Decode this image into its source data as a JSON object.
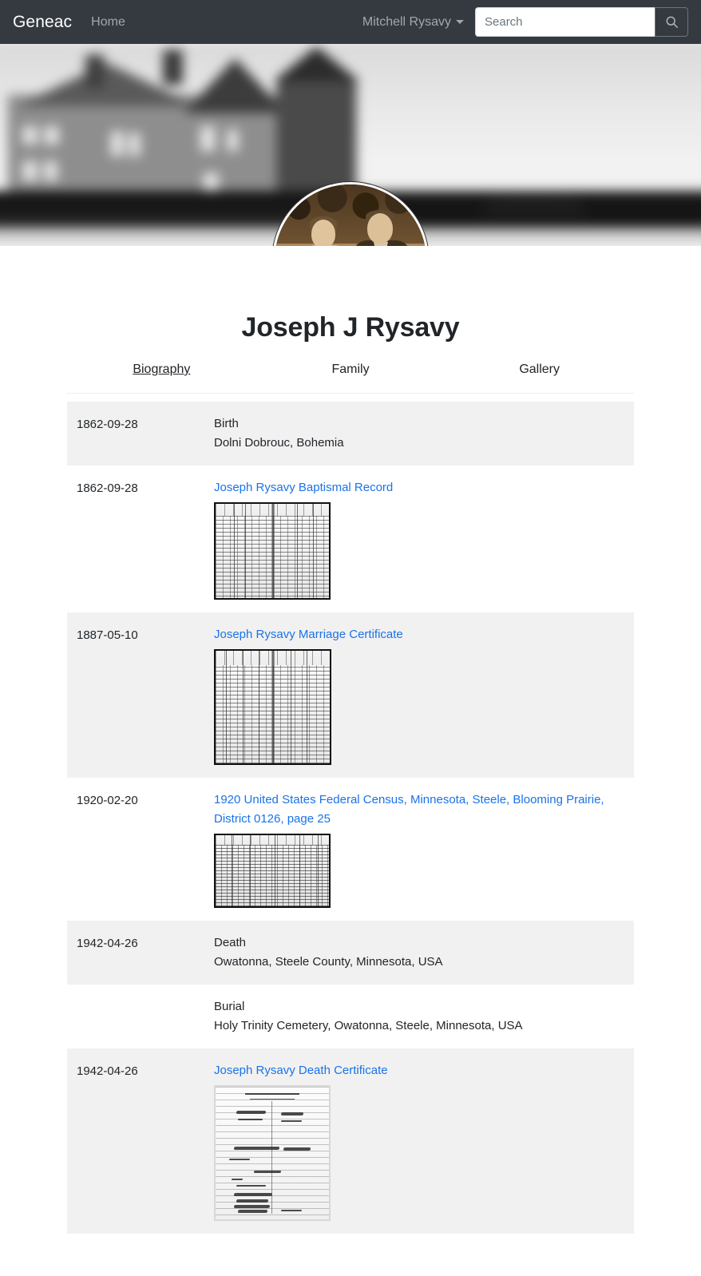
{
  "navbar": {
    "brand": "Geneac",
    "home_label": "Home",
    "user_label": "Mitchell Rysavy",
    "search_placeholder": "Search",
    "search_value": "",
    "search_icon": "search-icon",
    "caret_icon": "chevron-down-icon",
    "background_color": "#343a40"
  },
  "profile": {
    "name": "Joseph J Rysavy",
    "avatar_alt": "Sepia portrait of an elderly couple standing outdoors",
    "banner_alt": "Blurred black and white photograph of a large Victorian house"
  },
  "tabs": [
    {
      "label": "Biography",
      "active": true
    },
    {
      "label": "Family",
      "active": false
    },
    {
      "label": "Gallery",
      "active": false
    }
  ],
  "colors": {
    "link": "#1a73e8",
    "row_striped": "#f1f1f1",
    "text": "#212529",
    "divider": "#e9ecef"
  },
  "timeline": [
    {
      "date": "1862-09-28",
      "event": "Birth",
      "place": "Dolni Dobrouc, Bohemia",
      "link": "",
      "thumb": "",
      "striped": true
    },
    {
      "date": "1862-09-28",
      "event": "",
      "place": "",
      "link": "Joseph Rysavy Baptismal Record",
      "thumb": "baptismal-record-thumbnail",
      "striped": false
    },
    {
      "date": "1887-05-10",
      "event": "",
      "place": "",
      "link": "Joseph Rysavy Marriage Certificate",
      "thumb": "marriage-certificate-thumbnail",
      "striped": true
    },
    {
      "date": "1920-02-20",
      "event": "",
      "place": "",
      "link": "1920 United States Federal Census, Minnesota, Steele, Blooming Prairie, District 0126, page 25",
      "thumb": "census-page-thumbnail",
      "striped": false
    },
    {
      "date": "1942-04-26",
      "event": "Death",
      "place": "Owatonna, Steele County, Minnesota, USA",
      "link": "",
      "thumb": "",
      "striped": true
    },
    {
      "date": "",
      "event": "Burial",
      "place": "Holy Trinity Cemetery, Owatonna, Steele, Minnesota, USA",
      "link": "",
      "thumb": "",
      "striped": false
    },
    {
      "date": "1942-04-26",
      "event": "",
      "place": "",
      "link": "Joseph Rysavy Death Certificate",
      "thumb": "death-certificate-thumbnail",
      "striped": true
    }
  ]
}
